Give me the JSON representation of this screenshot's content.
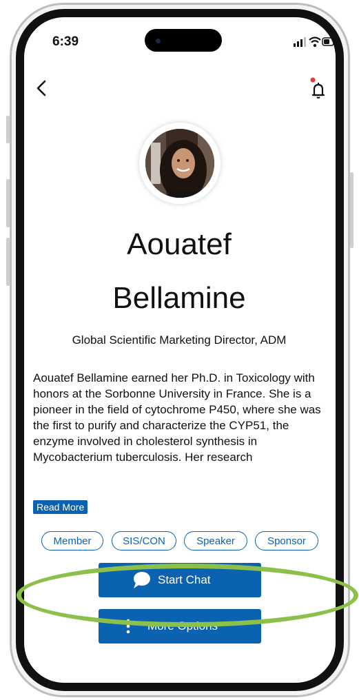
{
  "status_bar": {
    "time": "6:39"
  },
  "profile": {
    "name_line1": "Aouatef",
    "name_line2": "Bellamine",
    "title": "Global Scientific Marketing Director, ADM",
    "bio": "Aouatef Bellamine earned her Ph.D. in Toxicology with honors at the Sorbonne University in France. She is a pioneer in the field of cytochrome P450, where she was the first to purify and characterize the CYP51, the enzyme involved in cholesterol synthesis in Mycobacterium tuberculosis. Her research",
    "read_more": "Read More"
  },
  "tags": [
    "Member",
    "SIS/CON",
    "Speaker",
    "Sponsor"
  ],
  "actions": {
    "start_chat": "Start Chat",
    "more_options": "More Options"
  },
  "colors": {
    "accent": "#0b62b0",
    "annotation": "#8cc04a",
    "notification_dot": "#e53935"
  },
  "icons": [
    "back-arrow-icon",
    "bell-icon",
    "chat-bubble-icon",
    "more-vertical-icon"
  ]
}
